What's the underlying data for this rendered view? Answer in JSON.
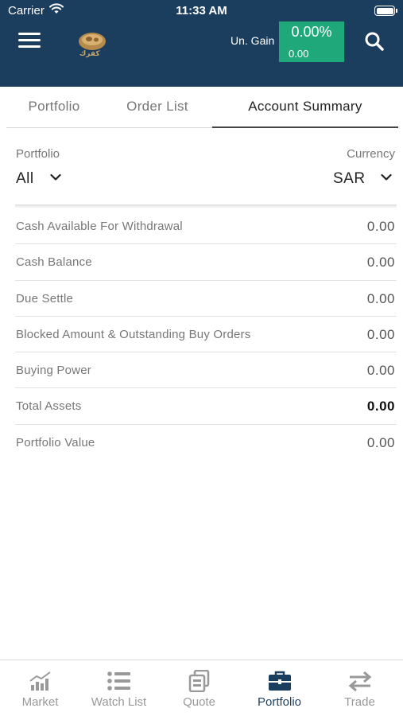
{
  "status_bar": {
    "carrier": "Carrier",
    "time": "11:33 AM"
  },
  "header": {
    "logo_text": "كفرك",
    "ungain_label": "Un. Gain",
    "ungain_percent": "0.00%",
    "ungain_value": "0.00",
    "ungain_color": "#1fa87a",
    "bar_color": "#1c3e5e"
  },
  "tabs": [
    {
      "label": "Portfolio",
      "active": false
    },
    {
      "label": "Order List",
      "active": false
    },
    {
      "label": "Account Summary",
      "active": true
    }
  ],
  "filters": {
    "portfolio_label": "Portfolio",
    "portfolio_value": "All",
    "currency_label": "Currency",
    "currency_value": "SAR"
  },
  "summary_rows": [
    {
      "label": "Cash Available For Withdrawal",
      "value": "0.00"
    },
    {
      "label": "Cash Balance",
      "value": "0.00"
    },
    {
      "label": "Due Settle",
      "value": "0.00"
    },
    {
      "label": "Blocked Amount & Outstanding Buy Orders",
      "value": "0.00"
    },
    {
      "label": "Buying Power",
      "value": "0.00"
    },
    {
      "label": "Total Assets",
      "value": "0.00"
    },
    {
      "label": "Portfolio Value",
      "value": "0.00"
    }
  ],
  "bottom_nav": [
    {
      "label": "Market",
      "icon": "chart-icon",
      "active": false
    },
    {
      "label": "Watch List",
      "icon": "list-icon",
      "active": false
    },
    {
      "label": "Quote",
      "icon": "quote-icon",
      "active": false
    },
    {
      "label": "Portfolio",
      "icon": "briefcase-icon",
      "active": true
    },
    {
      "label": "Trade",
      "icon": "exchange-icon",
      "active": false
    }
  ]
}
